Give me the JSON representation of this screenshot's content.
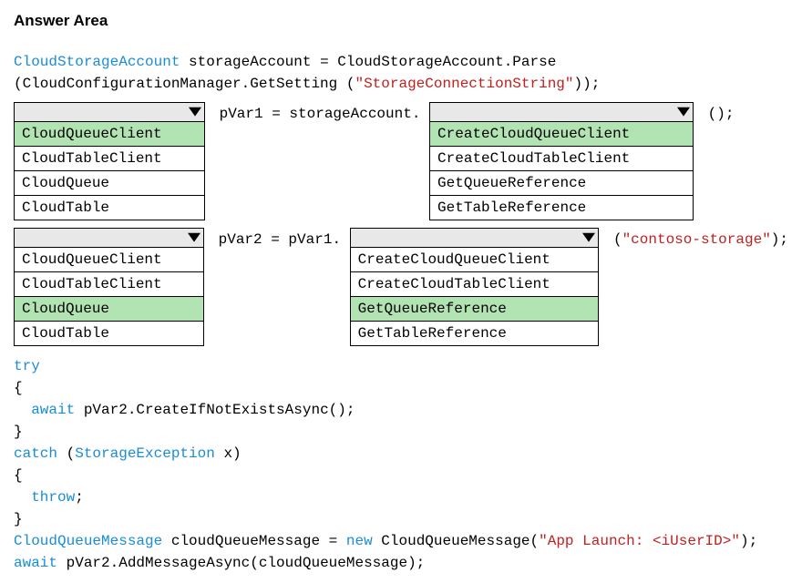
{
  "header": "Answer Area",
  "code": {
    "l1_a": "CloudStorageAccount",
    "l1_b": " storageAccount = CloudStorageAccount.Parse",
    "l2_a": "(CloudConfigurationManager.GetSetting (",
    "l2_b": "\"StorageConnectionString\"",
    "l2_c": "));",
    "r1_mid": " pVar1 = storageAccount. ",
    "r1_end": " ();",
    "r2_mid": " pVar2 = pVar1. ",
    "r2_end_a": " (",
    "r2_end_b": "\"contoso-storage\"",
    "r2_end_c": ");",
    "try": "try",
    "open1": "{",
    "await1a": "  await",
    "await1b": " pVar2.CreateIfNotExistsAsync();",
    "close1": "}",
    "catch_a": "catch",
    "catch_b": " (",
    "catch_c": "StorageException",
    "catch_d": " x)",
    "open2": "{",
    "throw_a": "  throw",
    "throw_b": ";",
    "close2": "}",
    "last1_a": "CloudQueueMessage",
    "last1_b": " cloudQueueMessage = ",
    "last1_c": "new",
    "last1_d": " CloudQueueMessage(",
    "last1_e": "\"App Launch: <iUserID>\"",
    "last1_f": ");",
    "last2_a": "await",
    "last2_b": " pVar2.AddMessageAsync(cloudQueueMessage);"
  },
  "dd1": {
    "items": [
      "CloudQueueClient",
      "CloudTableClient",
      "CloudQueue",
      "CloudTable"
    ],
    "selected": 0
  },
  "dd2": {
    "items": [
      "CreateCloudQueueClient",
      "CreateCloudTableClient",
      "GetQueueReference",
      "GetTableReference"
    ],
    "selected": 0
  },
  "dd3": {
    "items": [
      "CloudQueueClient",
      "CloudTableClient",
      "CloudQueue",
      "CloudTable"
    ],
    "selected": 2
  },
  "dd4": {
    "items": [
      "CreateCloudQueueClient",
      "CreateCloudTableClient",
      "GetQueueReference",
      "GetTableReference"
    ],
    "selected": 2
  }
}
